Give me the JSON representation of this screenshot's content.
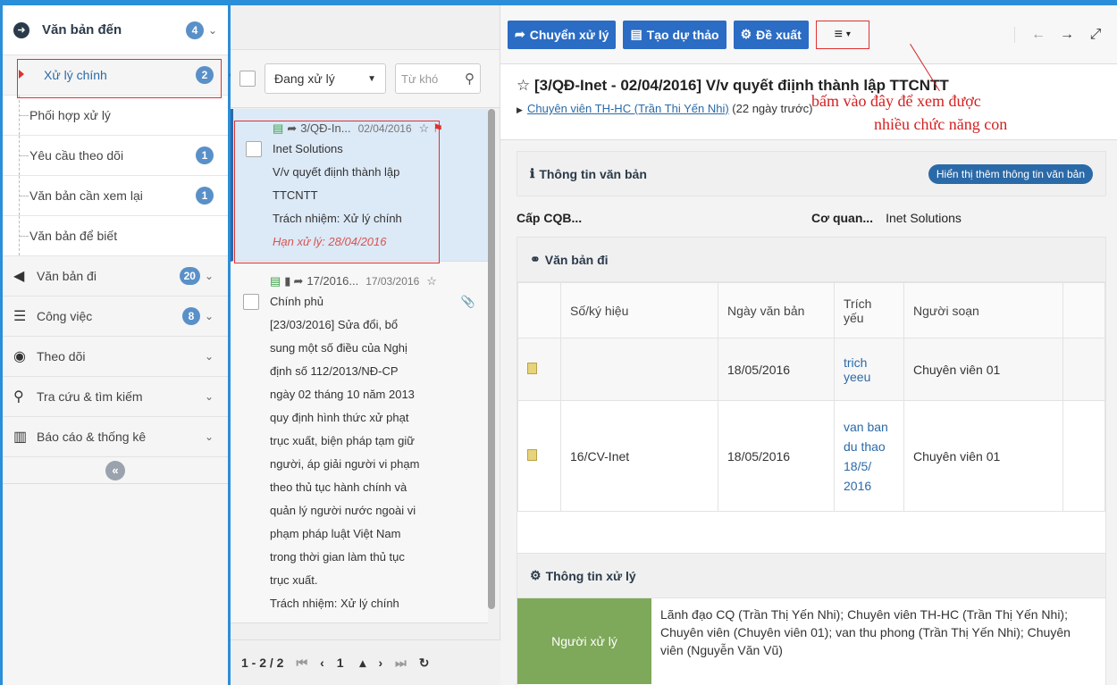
{
  "sidebar": {
    "header": {
      "title": "Văn bản đến",
      "badge": "4"
    },
    "subitems": [
      {
        "label": "Xử lý chính",
        "badge": "2"
      },
      {
        "label": "Phối hợp xử lý",
        "badge": ""
      },
      {
        "label": "Yêu cầu theo dõi",
        "badge": "1"
      },
      {
        "label": "Văn bản cần xem lại",
        "badge": "1"
      },
      {
        "label": "Văn bản để biết",
        "badge": ""
      }
    ],
    "sections": [
      {
        "label": "Văn bản đi",
        "badge": "20"
      },
      {
        "label": "Công việc",
        "badge": "8"
      },
      {
        "label": "Theo dõi",
        "badge": ""
      },
      {
        "label": "Tra cứu & tìm kiếm",
        "badge": ""
      },
      {
        "label": "Báo cáo & thống kê",
        "badge": ""
      }
    ]
  },
  "list": {
    "filter_value": "Đang xử lý",
    "search_placeholder": "Từ khó",
    "items": [
      {
        "code": "3/QĐ-In...",
        "date": "02/04/2016",
        "org": "Inet Solutions",
        "summary_1": "V/v quyết điịnh thành lập",
        "summary_2": "TTCNTT",
        "responsibility": "Trách nhiệm: Xử lý chính",
        "deadline": "Hạn xử lý: 28/04/2016"
      },
      {
        "code": "17/2016...",
        "date": "17/03/2016",
        "org": "Chính phủ",
        "lines": [
          "[23/03/2016] Sửa đổi, bổ",
          "sung một số điều của Nghị",
          "định số 112/2013/NĐ-CP",
          "ngày 02 tháng 10 năm 2013",
          "quy định hình thức xử phạt",
          "trục xuất, biện pháp tạm giữ",
          "người, áp giải người vi phạm",
          "theo thủ tục hành chính và",
          "quản lý người nước ngoài vi",
          "phạm pháp luật Việt Nam",
          "trong thời gian làm thủ tục",
          "trục xuất."
        ],
        "responsibility": "Trách nhiệm: Xử lý chính"
      }
    ],
    "pager": {
      "range": "1 - 2 / 2",
      "page": "1"
    }
  },
  "toolbar": {
    "forward": "Chuyển xử lý",
    "draft": "Tạo dự thảo",
    "propose": "Đề xuất"
  },
  "doc": {
    "title": "[3/QĐ-Inet - 02/04/2016] V/v quyết điịnh thành lập TTCNTT",
    "assignee": "Chuyên viên TH-HC (Trần Thi Yến Nhi)",
    "ago": "(22 ngày trước)",
    "annotation_1": "bấm vào đây để xem được",
    "annotation_2": "nhiều chức năng con"
  },
  "info_panel": {
    "title": "Thông tin văn bản",
    "more": "Hiển thị thêm thông tin văn bản",
    "field1": "Cấp CQB...",
    "field2_label": "Cơ quan...",
    "field2_value": "Inet Solutions"
  },
  "outgoing": {
    "title": "Văn bản đi",
    "headers": [
      "Số/ký hiệu",
      "Ngày văn bản",
      "Trích yếu",
      "Người soạn"
    ],
    "rows": [
      {
        "number": "",
        "date": "18/05/2016",
        "summary": "trich yeeu",
        "author": "Chuyên viên 01"
      },
      {
        "number": "16/CV-Inet",
        "date": "18/05/2016",
        "summary": "van ban du thao 18/5/ 2016",
        "author": "Chuyên viên 01"
      }
    ]
  },
  "processing": {
    "title": "Thông tin xử lý",
    "label": "Người xử lý",
    "value": "Lãnh đạo CQ (Trần Thị Yến Nhi); Chuyên viên TH-HC (Trần Thị Yến Nhi); Chuyên viên (Chuyên viên 01); van thu phong (Trần Thị Yến Nhi); Chuyên viên (Nguyễn Văn Vũ)"
  },
  "colors": {
    "primary": "#2b6cc4",
    "accent": "#2b8ed9",
    "annotation": "#d32020",
    "green": "#7ea85a"
  }
}
